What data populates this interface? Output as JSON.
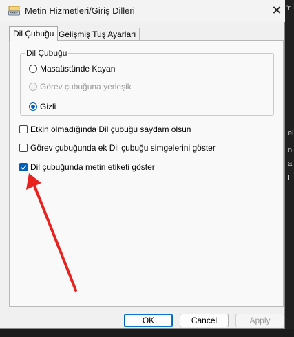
{
  "window": {
    "title": "Metin Hizmetleri/Giriş Dilleri",
    "close_symbol": "✕"
  },
  "tabs": [
    {
      "label": "Dil Çubuğu",
      "active": true
    },
    {
      "label": "Gelişmiş Tuş Ayarları",
      "active": false
    }
  ],
  "language_bar_group": {
    "legend": "Dil Çubuğu",
    "options": [
      {
        "label": "Masaüstünde Kayan",
        "checked": false,
        "enabled": true
      },
      {
        "label": "Görev çubuğuna yerleşik",
        "checked": false,
        "enabled": false
      },
      {
        "label": "Gizli",
        "checked": true,
        "enabled": true
      }
    ]
  },
  "checkboxes": [
    {
      "label": "Etkin olmadığında Dil çubuğu saydam olsun",
      "checked": false
    },
    {
      "label": "Görev çubuğunda ek Dil çubuğu simgelerini göster",
      "checked": false
    },
    {
      "label": "Dil çubuğunda metin etiketi göster",
      "checked": true
    }
  ],
  "buttons": {
    "ok": "OK",
    "cancel": "Cancel",
    "apply": "Apply"
  },
  "annotation": {
    "arrow_color": "#e8231f"
  },
  "colors": {
    "accent": "#005fb8",
    "dialog_bg": "#f0f0f0",
    "panel_bg": "#f9f9f9"
  }
}
